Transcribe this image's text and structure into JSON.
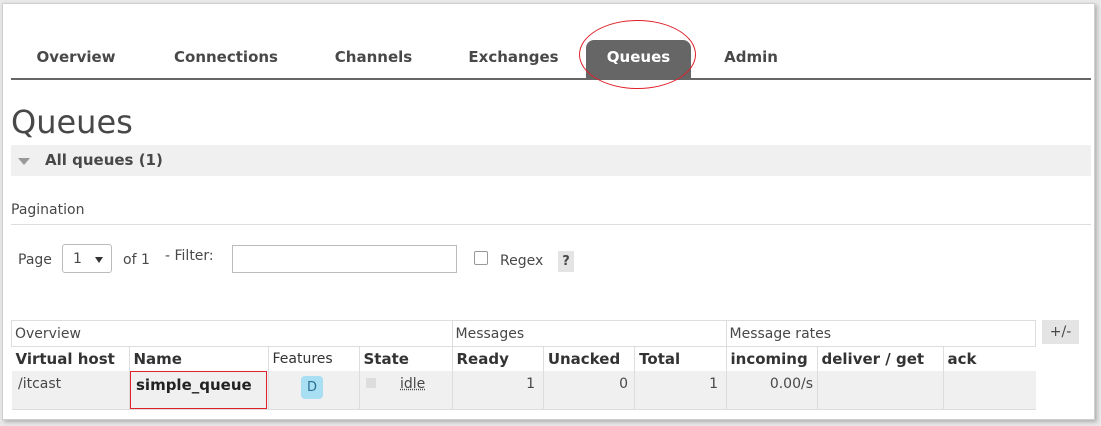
{
  "tabs": [
    "Overview",
    "Connections",
    "Channels",
    "Exchanges",
    "Queues",
    "Admin"
  ],
  "active_tab": "Queues",
  "page_title": "Queues",
  "section_title": "All queues (1)",
  "pagination": {
    "label": "Pagination",
    "page_label": "Page",
    "page_value": "1",
    "of_label": "of 1",
    "filter_label": "- Filter:",
    "filter_value": "",
    "regex_label": "Regex",
    "help": "?"
  },
  "table": {
    "groups": [
      "Overview",
      "Messages",
      "Message rates"
    ],
    "toggle": "+/-",
    "headers": [
      "Virtual host",
      "Name",
      "Features",
      "State",
      "Ready",
      "Unacked",
      "Total",
      "incoming",
      "deliver / get",
      "ack"
    ],
    "rows": [
      {
        "virtual_host": "/itcast",
        "name": "simple_queue",
        "features": "D",
        "state": "idle",
        "ready": "1",
        "unacked": "0",
        "total": "1",
        "incoming": "0.00/s",
        "deliver_get": "",
        "ack": ""
      }
    ]
  },
  "colors": {
    "active_tab_bg": "#666666",
    "annotation_red": "#e0202a",
    "feature_badge": "#a9dff3"
  }
}
